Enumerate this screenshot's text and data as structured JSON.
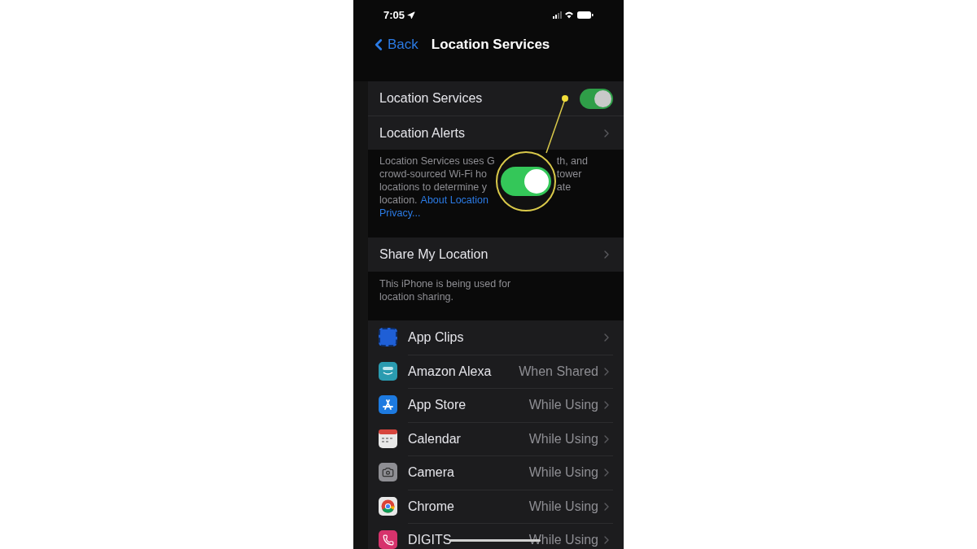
{
  "status_bar": {
    "time": "7:05"
  },
  "nav": {
    "back": "Back",
    "title": "Location Services"
  },
  "main_group": [
    {
      "kind": "toggle",
      "label": "Location Services",
      "on": true
    },
    {
      "kind": "link",
      "label": "Location Alerts"
    }
  ],
  "description": {
    "lines": [
      {
        "left": "Location Services uses G",
        "right": "th, and"
      },
      {
        "left": "crowd-sourced Wi-Fi ho",
        "right": "tower"
      },
      {
        "left": "locations to determine y",
        "right": "ate"
      },
      {
        "left": "location.",
        "link": "About Location"
      },
      {
        "link": "Privacy..."
      }
    ]
  },
  "callout": {
    "on": true
  },
  "share": {
    "label": "Share My Location",
    "footer": "This iPhone is being used for location sharing."
  },
  "apps": [
    {
      "name": "App Clips"
    },
    {
      "name": "Amazon Alexa",
      "value": "When Shared"
    },
    {
      "name": "App Store",
      "value": "While Using"
    },
    {
      "name": "Calendar",
      "value": "While Using"
    },
    {
      "name": "Camera",
      "value": "While Using"
    },
    {
      "name": "Chrome",
      "value": "While Using"
    },
    {
      "name": "DIGITS",
      "value": "While Using"
    }
  ]
}
